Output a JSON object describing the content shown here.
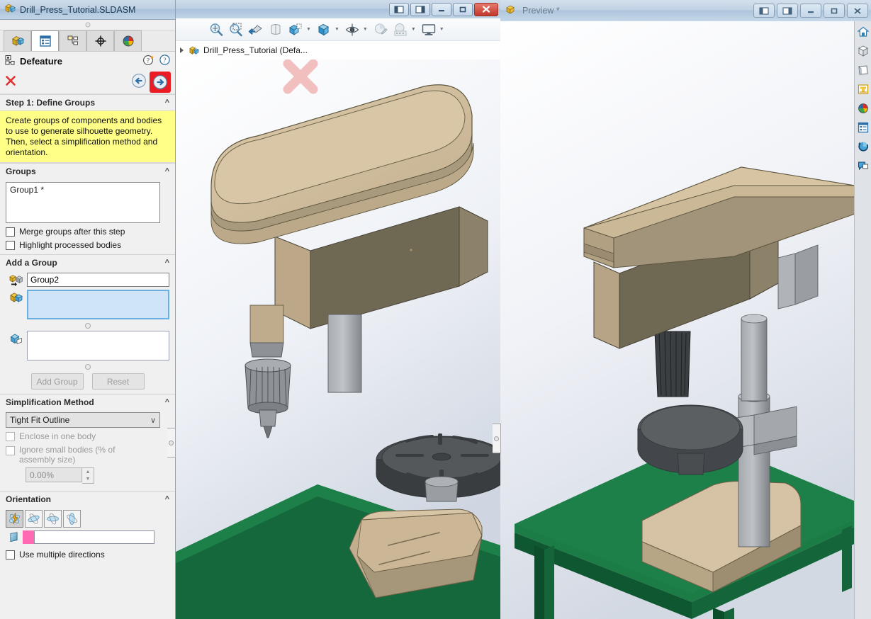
{
  "left_window": {
    "title": "Drill_Press_Tutorial.SLDASM",
    "title_icon": "assembly-icon",
    "tabs": [
      {
        "name": "feature-manager-tab",
        "icon": "assembly-cube-icon",
        "active": false
      },
      {
        "name": "property-manager-tab",
        "icon": "property-list-icon",
        "active": true
      },
      {
        "name": "configuration-manager-tab",
        "icon": "configuration-icon",
        "active": false
      },
      {
        "name": "dimxpert-manager-tab",
        "icon": "crosshair-icon",
        "active": false
      },
      {
        "name": "display-manager-tab",
        "icon": "color-sphere-icon",
        "active": false
      }
    ],
    "pm": {
      "title": "Defeature",
      "help_icon": "help-with-star-icon",
      "help2_icon": "help-icon",
      "cancel_icon": "red-x-icon",
      "back_icon": "back-arrow-icon",
      "next_icon": "next-arrow-icon",
      "next_highlight_color": "#ec1c24"
    },
    "step1": {
      "header": "Step 1: Define Groups",
      "tip": "Create groups of components and bodies to use to generate silhouette geometry. Then, select a simplification method and orientation.",
      "tip_bg": "#ffff88"
    },
    "groups": {
      "header": "Groups",
      "items": [
        "Group1 *"
      ],
      "checkboxes": [
        {
          "label": "Merge groups after this step",
          "checked": false
        },
        {
          "label": "Highlight processed bodies",
          "checked": false
        }
      ]
    },
    "add_group": {
      "header": "Add a Group",
      "name_icon": "group-name-icon",
      "name_value": "Group2",
      "components_icon": "component-cube-icon",
      "components_value": "",
      "components_selected": true,
      "bodies_icon": "solid-body-icon",
      "bodies_value": "",
      "add_button": "Add Group",
      "reset_button": "Reset",
      "buttons_disabled": true
    },
    "simplification": {
      "header": "Simplification Method",
      "selected": "Tight Fit Outline",
      "options": [
        "Tight Fit Outline"
      ],
      "enclose_label": "Enclose in one body",
      "enclose_checked": false,
      "ignore_label": "Ignore small bodies (% of assembly size)",
      "ignore_checked": false,
      "percent_value": "0.00%"
    },
    "orientation": {
      "header": "Orientation",
      "buttons": [
        {
          "name": "orientation-auto-icon",
          "selected": true
        },
        {
          "name": "orientation-x-icon",
          "selected": false
        },
        {
          "name": "orientation-y-icon",
          "selected": false
        },
        {
          "name": "orientation-z-icon",
          "selected": false
        }
      ],
      "plane_icon": "plane-icon",
      "swatch_color": "#ff69b4",
      "direction_value": "",
      "multi_label": "Use multiple directions",
      "multi_checked": false
    }
  },
  "main_window": {
    "window_buttons": [
      {
        "name": "restore-left-button",
        "glyph": "◧"
      },
      {
        "name": "restore-right-button",
        "glyph": "◨"
      },
      {
        "name": "minimize-button",
        "glyph": "—"
      },
      {
        "name": "maximize-button",
        "glyph": "▢"
      },
      {
        "name": "close-button",
        "glyph": "✕"
      }
    ],
    "toolbar": [
      {
        "name": "zoom-to-fit-icon",
        "dropdown": false
      },
      {
        "name": "zoom-to-area-icon",
        "dropdown": false
      },
      {
        "name": "previous-view-icon",
        "dropdown": false
      },
      {
        "name": "section-view-icon",
        "dropdown": false
      },
      {
        "name": "view-orientation-icon",
        "dropdown": true
      },
      {
        "name": "display-style-icon",
        "dropdown": true
      },
      {
        "name": "hide-show-items-icon",
        "dropdown": true
      },
      {
        "name": "edit-appearance-icon",
        "dropdown": false
      },
      {
        "name": "apply-scene-icon",
        "dropdown": true
      },
      {
        "name": "view-settings-icon",
        "dropdown": true
      }
    ],
    "tree_node": {
      "label": "Drill_Press_Tutorial  (Defa...",
      "icon": "assembly-icon",
      "expander": "collapsed"
    },
    "watermark_icon": "large-x-watermark"
  },
  "preview_window": {
    "title": "Preview *",
    "title_icon": "preview-icon",
    "window_buttons": [
      {
        "name": "restore-left-button",
        "glyph": "◧"
      },
      {
        "name": "restore-right-button",
        "glyph": "◨"
      },
      {
        "name": "minimize-button",
        "glyph": "—"
      },
      {
        "name": "maximize-button",
        "glyph": "▢"
      },
      {
        "name": "close-button",
        "glyph": "✕"
      }
    ],
    "right_toolbar": [
      {
        "name": "view-home-icon"
      },
      {
        "name": "view-isometric-icon"
      },
      {
        "name": "view-normal-to-icon"
      },
      {
        "name": "view-section-icon"
      },
      {
        "name": "appearance-sphere-icon"
      },
      {
        "name": "display-pane-icon"
      },
      {
        "name": "rotate-refresh-icon"
      },
      {
        "name": "comment-icon"
      }
    ]
  },
  "model": {
    "colors": {
      "tan_light": "#d6c3a5",
      "tan_mid": "#b8a588",
      "tan_dark": "#8e8067",
      "gray_light": "#b4b7bb",
      "gray_mid": "#8e9196",
      "gray_dark": "#55585c",
      "green_light": "#1e7a45",
      "green_mid": "#14663a",
      "green_dark": "#0d4d2b",
      "bg_top": "#ffffff",
      "bg_bottom": "#d8dde6"
    }
  }
}
